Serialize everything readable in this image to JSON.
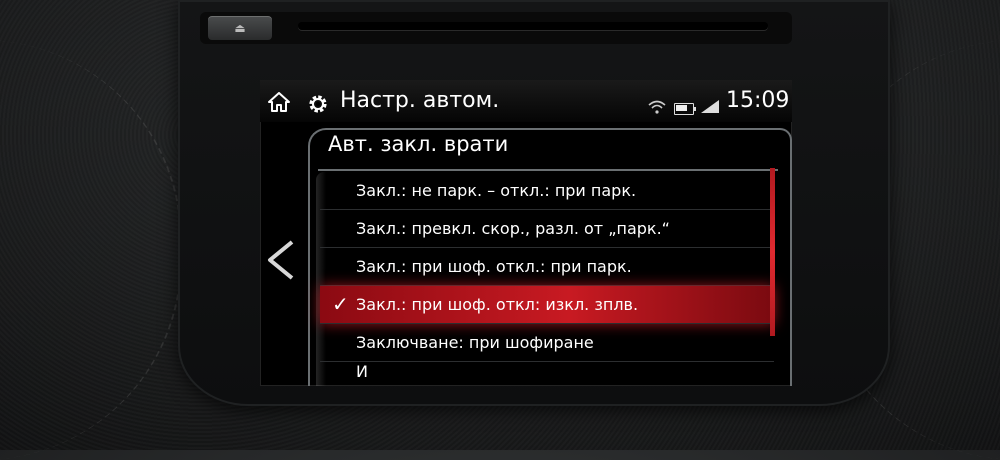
{
  "device": {
    "eject_symbol": "⏏"
  },
  "topbar": {
    "title": "Настр. автом.",
    "time": "15:09",
    "icons": [
      "home-icon",
      "gear-icon",
      "wifi-icon",
      "battery-icon",
      "signal-icon"
    ]
  },
  "panel": {
    "header": "Авт. закл. врати",
    "back_icon": "chevron-left-icon"
  },
  "list": {
    "items": [
      {
        "label": "Закл.: не парк. – откл.: при парк.",
        "selected": false
      },
      {
        "label": "Закл.: превкл. скор., разл. от „парк.“",
        "selected": false
      },
      {
        "label": "Закл.: при шоф. откл.: при парк.",
        "selected": false
      },
      {
        "label": "Закл.: при шоф. откл: изкл. зплв.",
        "selected": true
      },
      {
        "label": "Заключване: при шофиране",
        "selected": false
      },
      {
        "label": "И",
        "selected": false
      }
    ],
    "check_symbol": "✓"
  },
  "colors": {
    "accent_red": "#c81a22",
    "text": "#ffffff",
    "divider": "#6a6f72"
  }
}
